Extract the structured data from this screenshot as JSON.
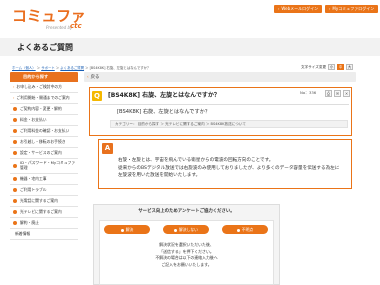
{
  "header": {
    "logo_main": "コミュファ",
    "logo_sub": "Presented by",
    "logo_ctc": "ctc",
    "links": [
      {
        "label": "Webメールログイン"
      },
      {
        "label": "Myコミュファログイン"
      }
    ]
  },
  "page_title": "よくあるご質問",
  "breadcrumb": {
    "items": [
      "ホーム（個人）",
      "サポート",
      "よくあるご質問"
    ],
    "current": "[BS4K8K] 右旋、左旋とはなんですか？"
  },
  "font_size": {
    "label": "文字サイズ変更",
    "options": [
      "小",
      "中",
      "大"
    ],
    "selected": "中"
  },
  "sidebar": {
    "title": "目的から探す",
    "items": [
      {
        "label": "お申し込み・ご検討中の方"
      },
      {
        "label": "ご利用開始・開通までのご案内"
      },
      {
        "label": "ご契約内容・変更・解約"
      },
      {
        "label": "料金・お支払い"
      },
      {
        "label": "ご利用料金の確認・お支払い"
      },
      {
        "label": "お引越し・移転のお手続き"
      },
      {
        "label": "設定・サービスのご案内"
      },
      {
        "label": "ID・パスワード・Myコミュファ管理"
      },
      {
        "label": "機器・宅内工事"
      },
      {
        "label": "ご利用トラブル"
      },
      {
        "label": "光電話に関するご案内"
      },
      {
        "label": "光テレビに関するご案内"
      },
      {
        "label": "解約・廃止"
      }
    ],
    "sub_item": "新着情報"
  },
  "back_label": "戻る",
  "question": {
    "badge": "Q",
    "title": "[BS4K8K] 右旋、左旋とはなんですか？",
    "number_label": "No：336",
    "subtitle": "[BS4K8K] 右旋、左旋とはなんですか？",
    "category": "カテゴリー： 目的から探す ＞ 光テレビに関するご案内 ＞ BS4K8K放送について"
  },
  "answer": {
    "badge": "A",
    "lines": [
      "右旋・左旋とは、宇宙を飛んでいる衛星からの電波の回転方向のことです。",
      "従来からのBSデジタル放送では右旋波のみ使用しておりましたが、より多くのデータ容量を伝送する為左に",
      "左旋波を用いた放送を開始いたします。"
    ]
  },
  "survey": {
    "title": "サービス向上のためアンケートご協力ください。",
    "buttons": [
      "解決",
      "解決しない",
      "不明点"
    ],
    "lines": [
      "解決状況を選択いただいた後、",
      "「送信する」を押下ください。",
      "不解決の場合は以下の連絡入力後へ",
      "ご記入をお願いいたします。"
    ]
  }
}
